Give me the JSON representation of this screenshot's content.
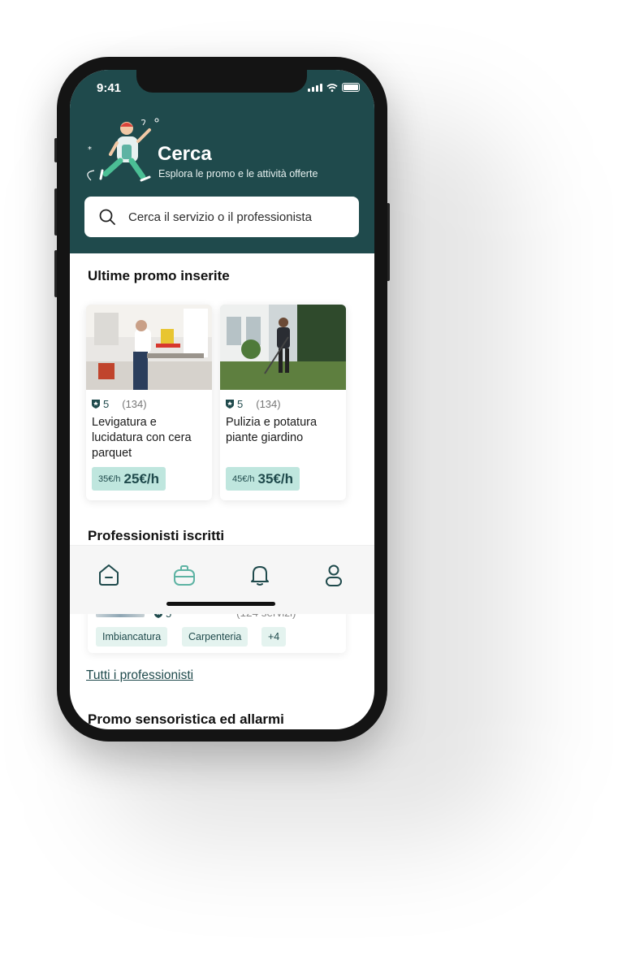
{
  "status": {
    "time": "9:41"
  },
  "header": {
    "title": "Cerca",
    "subtitle": "Esplora le promo e le attività offerte",
    "search_placeholder": "Cerca il servizio o il professionista"
  },
  "sections": {
    "latest_promos": "Ultime promo inserite",
    "professionals": "Professionisti iscritti",
    "all_professionals_link": "Tutti i professionisti",
    "sensor_promos": "Promo sensoristica ed allarmi"
  },
  "promos": [
    {
      "rating": "5",
      "count": "(134)",
      "title": "Levigatura e lucidatura con cera parquet",
      "old_price": "35€/h",
      "new_price": "25€/h"
    },
    {
      "rating": "5",
      "count": "(134)",
      "title": "Pulizia e potatura piante giardino",
      "old_price": "45€/h",
      "new_price": "35€/h"
    }
  ],
  "professional": {
    "rating": "5",
    "services": "(124 servizi)",
    "tags": [
      "Imbiancatura",
      "Carpenteria",
      "+4"
    ]
  },
  "tabbar": {
    "icons": [
      "home-icon",
      "briefcase-icon",
      "bell-icon",
      "user-icon"
    ],
    "active_color": "#5db3a3",
    "inactive_color": "#1f4a4c"
  },
  "colors": {
    "header": "#1f4a4c",
    "price_badge": "#bfe6de",
    "accent": "#5db3a3"
  }
}
